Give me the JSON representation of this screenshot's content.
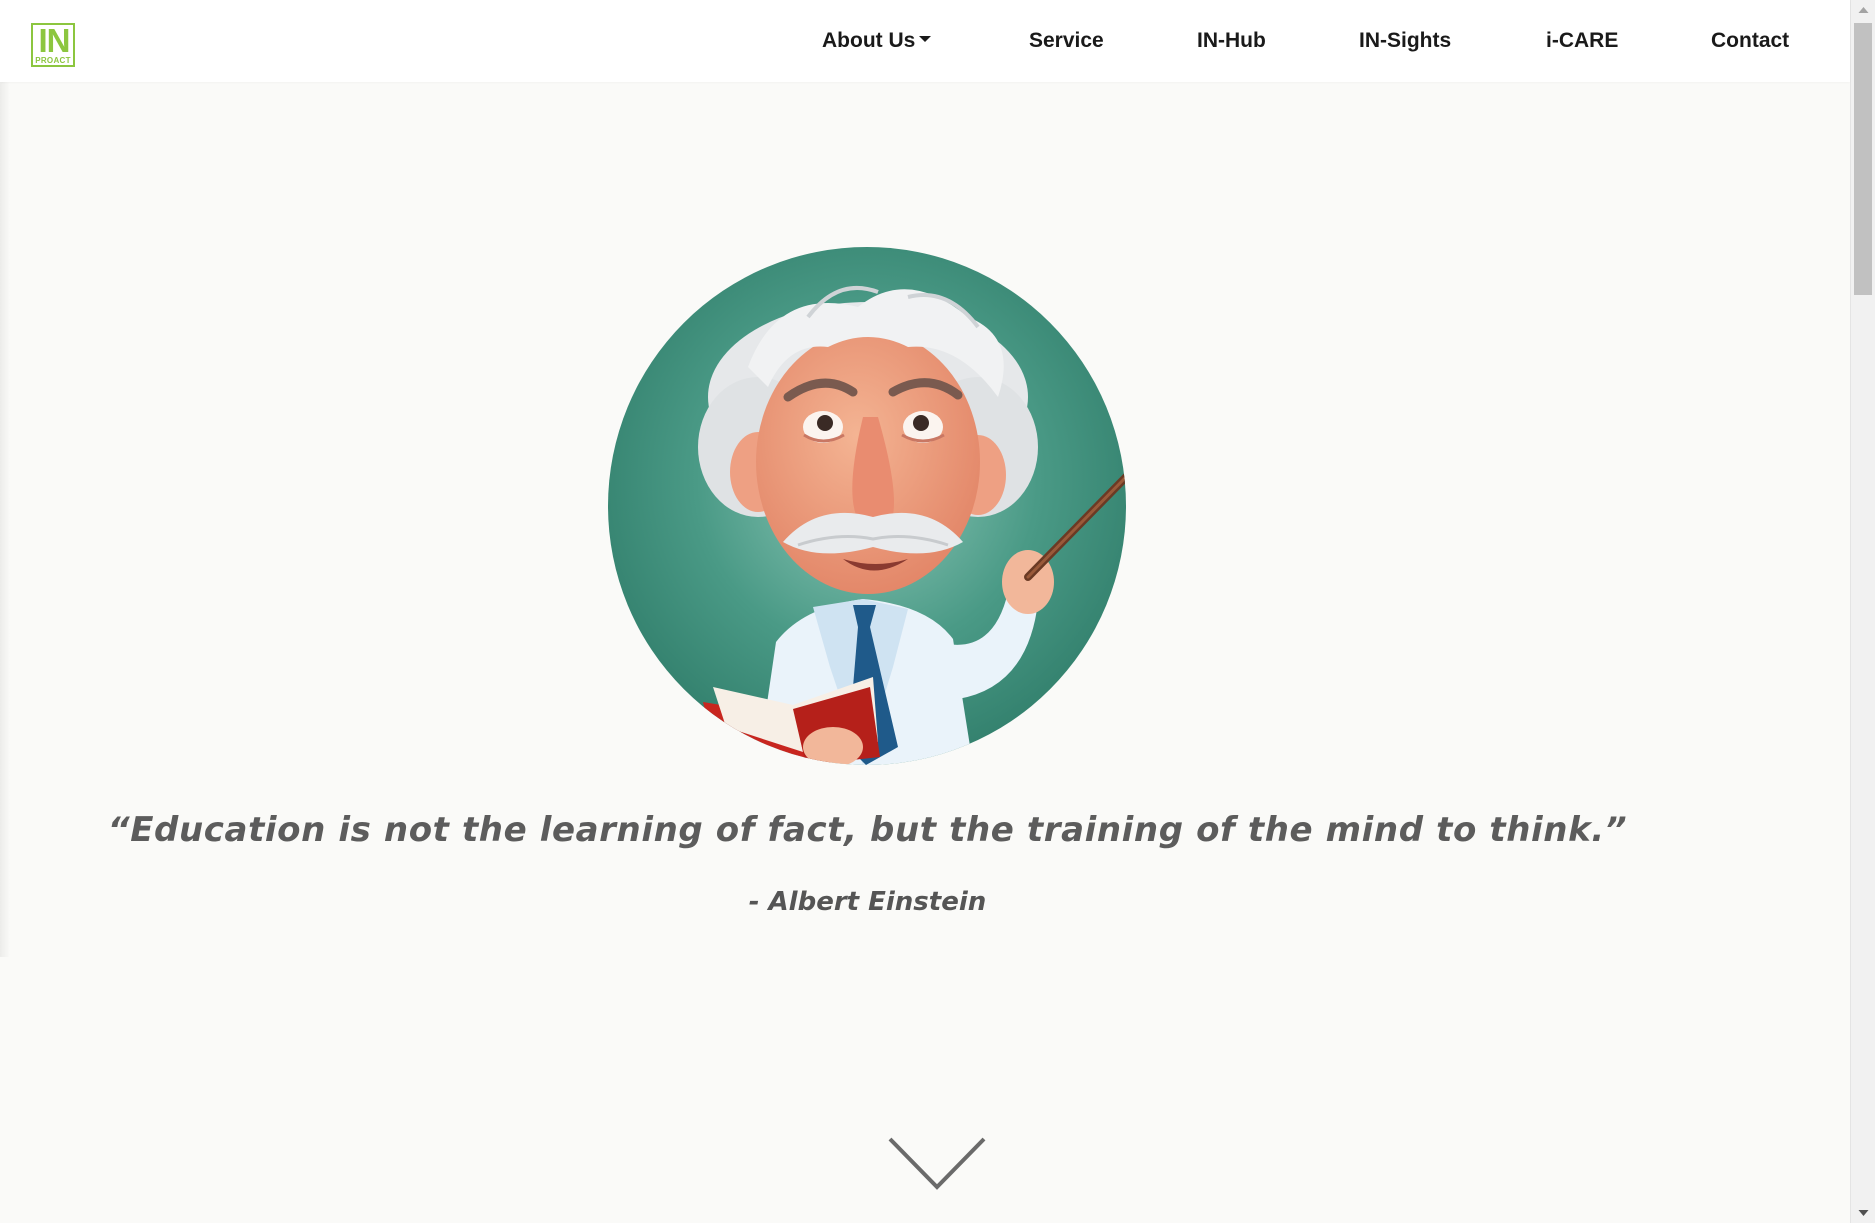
{
  "logo": {
    "big_text": "IN",
    "small_text": "PROACT",
    "color": "#8cc63f"
  },
  "nav": {
    "about": "About Us",
    "service": "Service",
    "inhub": "IN-Hub",
    "insights": "IN-Sights",
    "icare": "i-CARE",
    "contact": "Contact"
  },
  "hero": {
    "portrait_icon": "professor-illustration",
    "quote": "“Education is not the learning of fact, but the training of the mind to think.”",
    "author": "- Albert Einstein",
    "scroll_icon": "chevron-down-icon"
  },
  "colors": {
    "background": "#fafaf8",
    "text": "#5c5c5c",
    "accent": "#8cc63f"
  }
}
